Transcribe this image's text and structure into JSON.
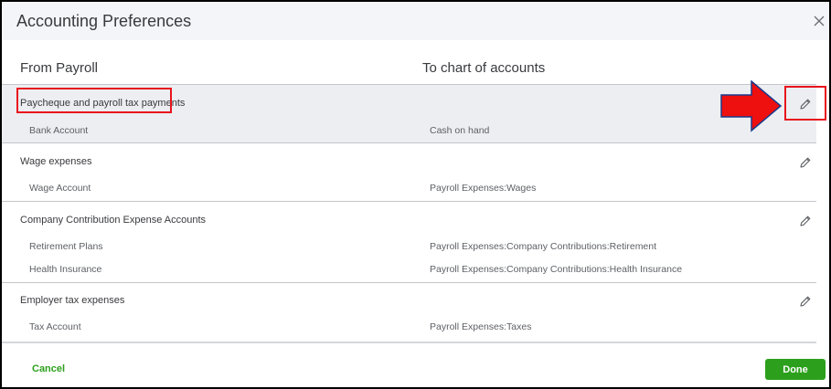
{
  "dialog": {
    "title": "Accounting Preferences"
  },
  "columns": {
    "from": "From Payroll",
    "to": "To chart of accounts"
  },
  "sections": [
    {
      "title": "Paycheque and payroll tax payments",
      "rows": [
        {
          "from": "Bank Account",
          "to": "Cash on hand"
        }
      ]
    },
    {
      "title": "Wage expenses",
      "rows": [
        {
          "from": "Wage Account",
          "to": "Payroll Expenses:Wages"
        }
      ]
    },
    {
      "title": "Company Contribution Expense Accounts",
      "rows": [
        {
          "from": "Retirement Plans",
          "to": "Payroll Expenses:Company Contributions:Retirement"
        },
        {
          "from": "Health Insurance",
          "to": "Payroll Expenses:Company Contributions:Health Insurance"
        }
      ]
    },
    {
      "title": "Employer tax expenses",
      "rows": [
        {
          "from": "Tax Account",
          "to": "Payroll Expenses:Taxes"
        }
      ]
    }
  ],
  "footer": {
    "cancel_label": "Cancel",
    "done_label": "Done"
  },
  "icons": {
    "close": "close-icon",
    "edit": "pencil-icon"
  },
  "colors": {
    "accent_green": "#2ca01c",
    "annotation_red": "#e8131d",
    "highlight_row": "#eceef1"
  }
}
